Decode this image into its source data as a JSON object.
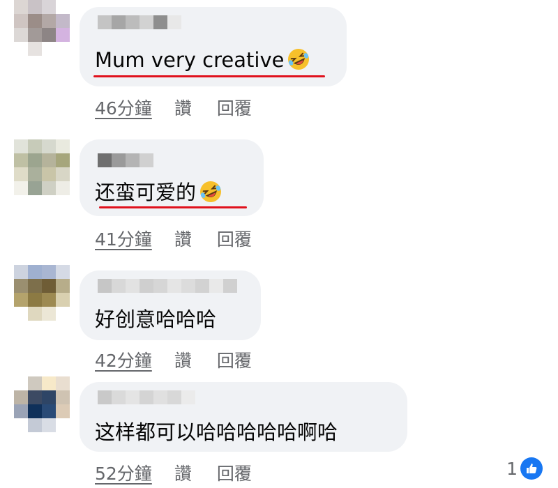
{
  "comments": [
    {
      "text": "Mum very creative",
      "emoji": "rolling-on-floor-laughing",
      "time": "46分鐘",
      "like_label": "讚",
      "reply_label": "回覆"
    },
    {
      "text": "还蛮可爱的",
      "emoji": "rolling-on-floor-laughing",
      "time": "41分鐘",
      "like_label": "讚",
      "reply_label": "回覆"
    },
    {
      "text": "好创意哈哈哈",
      "time": "42分鐘",
      "like_label": "讚",
      "reply_label": "回覆"
    },
    {
      "text": "这样都可以哈哈哈哈哈啊哈",
      "time": "52分鐘",
      "like_label": "讚",
      "reply_label": "回覆",
      "reaction_count": "1",
      "reaction_icon": "thumbs-up-icon"
    }
  ],
  "colors": {
    "bubble": "#f0f2f5",
    "meta_text": "#65676b",
    "underline_mark": "#e0111c",
    "like_blue": "#1877f2"
  }
}
